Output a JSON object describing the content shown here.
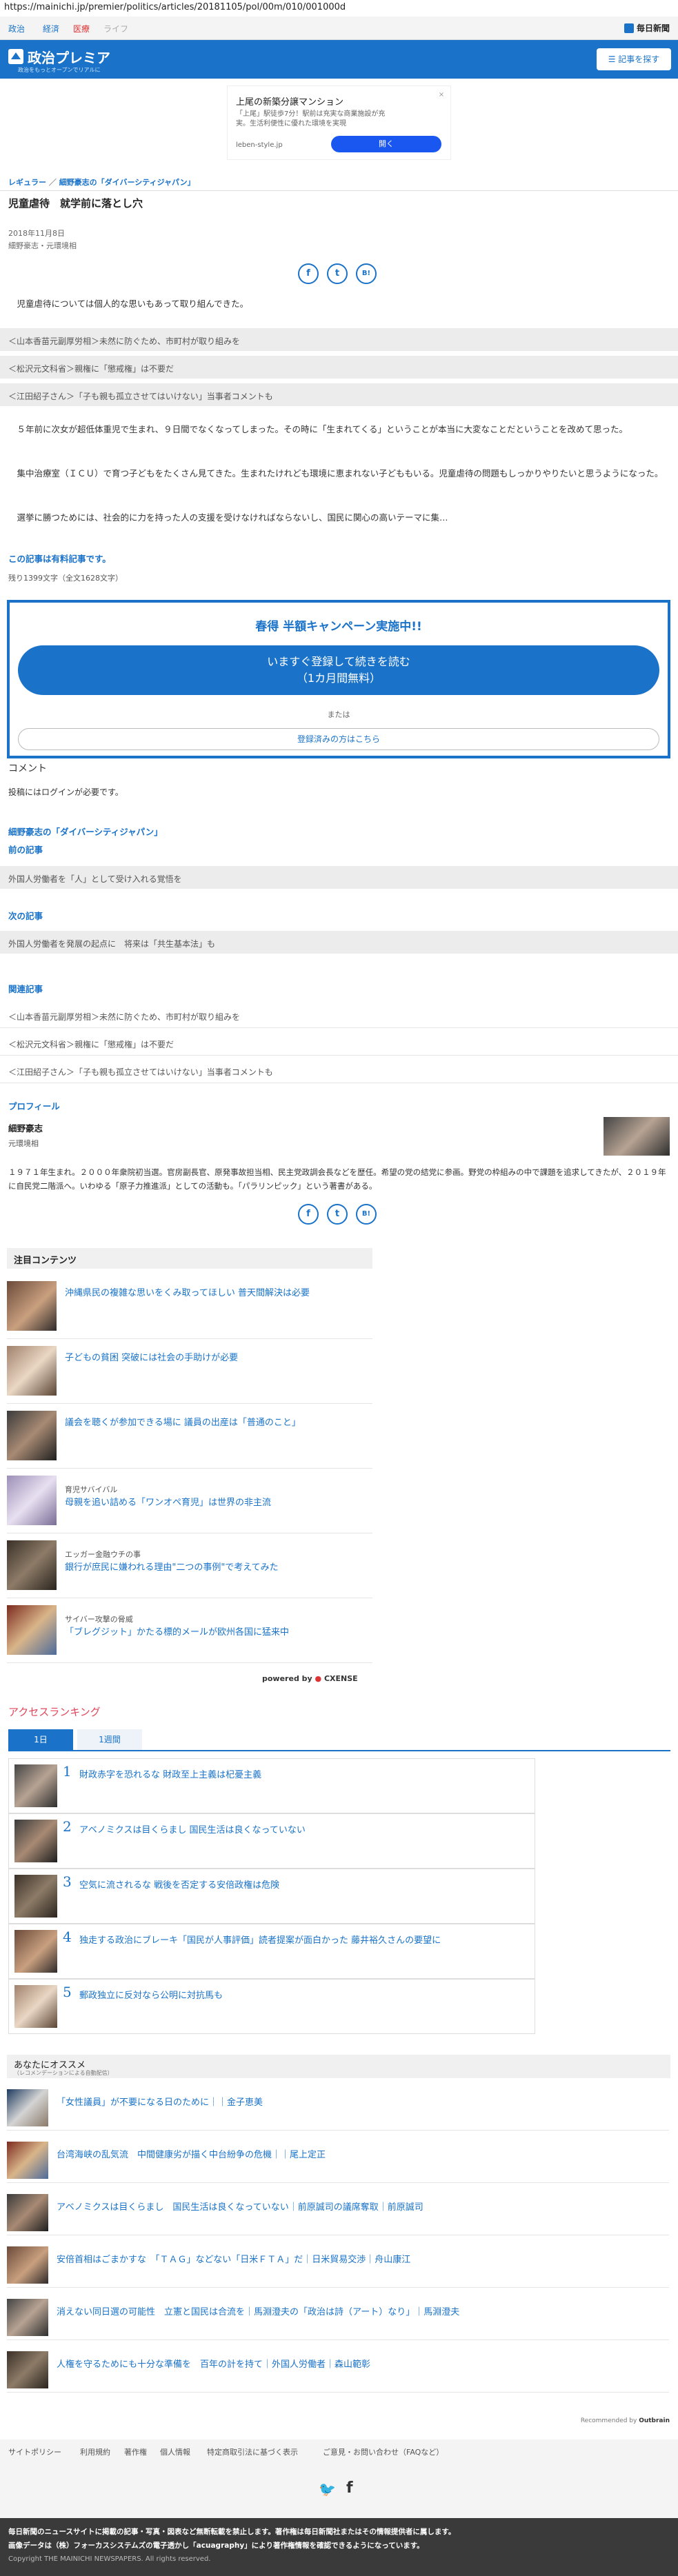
{
  "browser": {
    "url": "https://mainichi.jp/premier/politics/articles/20181105/pol/00m/010/001000d"
  },
  "topnav": {
    "items": [
      "政治",
      "経済",
      "医療",
      "ライフ"
    ],
    "brand": "毎日新聞"
  },
  "header": {
    "title": "政治プレミア",
    "subtitle": "政治をもっとオープンでリアルに",
    "menu_button": "記事を探す"
  },
  "ad": {
    "title": "上尾の新築分譲マンション",
    "desc": "「上尾」駅徒歩7分！駅前は充実な商業施設が充実。生活利便性に優れた環境を実現",
    "site": "leben-style.jp",
    "cta": "開く",
    "close": "×"
  },
  "article": {
    "breadcrumb": [
      "レギュラー",
      "細野豪志の「ダイバーシティジャパン」"
    ],
    "title": "児童虐待　就学前に落とし穴",
    "date": "2018年11月8日",
    "author": "細野豪志・元環境相",
    "lead": "児童虐待については個人的な思いもあって取り組んできた。",
    "related_top": [
      "＜山本香苗元副厚労相＞未然に防ぐため、市町村が取り組みを",
      "＜松沢元文科省＞親権に「懲戒権」は不要だ",
      "＜江田紹子さん＞「子も親も孤立させてはいけない」当事者コメントも"
    ],
    "paragraphs": [
      "５年前に次女が超低体重児で生まれ、９日間でなくなってしまった。その時に「生まれてくる」ということが本当に大変なことだということを改めて思った。",
      "集中治療室（ＩＣＵ）で育つ子どもをたくさん見てきた。生まれたけれども環境に恵まれない子どももいる。児童虐待の問題もしっかりやりたいと思うようになった。",
      "選挙に勝つためには、社会的に力を持った人の支援を受けなければならないし、国民に関心の高いテーマに集…"
    ],
    "paywall_label": "この記事は有料記事です。",
    "remaining": "残り1399文字（全文1628文字）"
  },
  "campaign": {
    "heading": "春得 半額キャンペーン実施中!!",
    "button_line1": "いますぐ登録して続きを読む",
    "button_line2": "（1カ月間無料）",
    "or": "または",
    "login": "登録済みの方はこちら"
  },
  "comment": {
    "title": "コメント",
    "note": "投稿にはログインが必要です。"
  },
  "series": {
    "series_label": "細野豪志の「ダイバーシティジャパン」",
    "prev_label": "前の記事",
    "prev_title": "外国人労働者を「人」として受け入れる覚悟を",
    "next_label": "次の記事",
    "next_title": "外国人労働者を発展の起点に　将来は「共生基本法」も"
  },
  "related": {
    "label": "関連記事",
    "items": [
      "＜山本香苗元副厚労相＞未然に防ぐため、市町村が取り組みを",
      "＜松沢元文科省＞親権に「懲戒権」は不要だ",
      "＜江田紹子さん＞「子も親も孤立させてはいけない」当事者コメントも"
    ]
  },
  "profile": {
    "label": "プロフィール",
    "name": "細野豪志",
    "role": "元環境相",
    "bio": "１９７１年生まれ。２０００年衆院初当選。官房副長官、原発事故担当相、民主党政調会長などを歴任。希望の党の結党に参画。野党の枠組みの中で課題を追求してきたが、２０１９年に自民党二階派へ。いわゆる「原子力推進派」としての活動も。「パラリンピック」という著書がある。"
  },
  "featured": {
    "title": "注目コンテンツ",
    "items": [
      {
        "cat": "",
        "title": "沖縄県民の複雑な思いをくみ取ってほしい 普天間解決は必要"
      },
      {
        "cat": "",
        "title": "子どもの貧困 突破には社会の手助けが必要"
      },
      {
        "cat": "",
        "title": "議会を聴くが参加できる場に 議員の出産は「普通のこと」"
      },
      {
        "cat": "育児サバイバル",
        "title": "母親を追い詰める「ワンオペ育児」は世界の非主流"
      },
      {
        "cat": "エッガー金融ウチの事",
        "title": "銀行が庶民に嫌われる理由\"二つの事例\"で考えてみた"
      },
      {
        "cat": "サイバー攻撃の脅威",
        "title": "「ブレグジット」かたる標的メールが欧州各国に猛来中"
      }
    ],
    "powered": "powered by",
    "powered_brand": "CXENSE"
  },
  "ranking": {
    "title": "アクセスランキング",
    "tabs": [
      "1日",
      "1週間"
    ],
    "items": [
      {
        "num": "1",
        "title": "財政赤字を恐れるな 財政至上主義は杞憂主義"
      },
      {
        "num": "2",
        "title": "アベノミクスは目くらまし 国民生活は良くなっていない"
      },
      {
        "num": "3",
        "title": "空気に流されるな 戦後を否定する安倍政権は危険"
      },
      {
        "num": "4",
        "title": "独走する政治にブレーキ「国民が人事評価」読者提案が面白かった 藤井裕久さんの要望に"
      },
      {
        "num": "5",
        "title": "郵政独立に反対なら公明に対抗馬も"
      }
    ]
  },
  "recommend": {
    "title": "あなたにオススメ",
    "sub": "（レコメンデーションによる自動配信）",
    "items": [
      "「女性議員」が不要になる日のために｜｜金子恵美",
      "台湾海峡の乱気流　中間健康劣が描く中台紛争の危機｜｜尾上定正",
      "アベノミクスは目くらまし　国民生活は良くなっていない｜前原誠司の議席奪取｜前原誠司",
      "安倍首相はごまかすな　「ＴＡＧ」などない「日米ＦＴＡ」だ｜日米貿易交渉｜舟山康江",
      "消えない同日選の可能性　立憲と国民は合流を｜馬淵澄夫の「政治は詩（アート）なり」｜馬淵澄夫",
      "人権を守るためにも十分な準備を　百年の計を持て｜外国人労働者｜森山範彰"
    ],
    "outbrain": "Recommended by",
    "outbrain_brand": "Outbrain"
  },
  "footer": {
    "links": [
      "サイトポリシー",
      "利用規約",
      "著作権",
      "個人情報",
      "特定商取引法に基づく表示",
      "ご意見・お問い合わせ（FAQなど）"
    ],
    "notice1": "毎日新聞のニュースサイトに掲載の記事・写真・図表など無断転載を禁止します。著作権は毎日新聞社またはその情報提供者に属します。",
    "notice2": "画像データは（株）フォーカスシステムズの電子透かし「acuagraphy」により著作権情報を確認できるようになっています。",
    "copyright": "Copyright THE MAINICHI NEWSPAPERS. All rights reserved."
  },
  "colors": {
    "brand_blue": "#1a73c8",
    "ranking_red": "#e0475a"
  }
}
